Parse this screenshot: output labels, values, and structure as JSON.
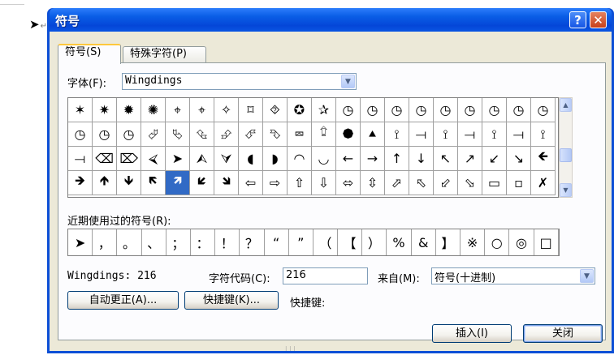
{
  "doc": {
    "mark_glyph": "➤",
    "return_glyph": "↵"
  },
  "window": {
    "title": "符号",
    "help_label": "?",
    "close_label": "✕"
  },
  "tabs": [
    {
      "label": "符号(S)",
      "active": true
    },
    {
      "label": "特殊字符(P)",
      "active": false
    }
  ],
  "font": {
    "label": "字体(F):",
    "value": "Wingdings"
  },
  "grid": {
    "selected_index": 64,
    "cells": [
      "✶",
      "✷",
      "✹",
      "✺",
      "⌖",
      "⌖",
      "✧",
      "⌑",
      "⯑",
      "✪",
      "✰",
      "◷",
      "◷",
      "◷",
      "◷",
      "◷",
      "◷",
      "◷",
      "◷",
      "◷",
      "◷",
      "◷",
      "◷",
      "⮰",
      "⮱",
      "⮴",
      "⮵",
      "⮶",
      "⮷",
      "⮹",
      "⮸",
      "⯄",
      "⯅",
      "⟟",
      "⟞",
      "⟟",
      "⟞",
      "⟟",
      "⟞",
      "⟟",
      "⟞",
      "⌫",
      "⌦",
      "⮘",
      "➤",
      "⮙",
      "⮛",
      "◖",
      "◗",
      "◠",
      "◡",
      "←",
      "→",
      "↑",
      "↓",
      "↖",
      "↗",
      "↙",
      "↘",
      "🡸",
      "🡺",
      "🡹",
      "🡻",
      "🡼",
      "🡽",
      "🡿",
      "🡾",
      "⇦",
      "⇨",
      "⇧",
      "⇩",
      "⬄",
      "⇳",
      "⬀",
      "⬁",
      "⬃",
      "⬂",
      "▭",
      "▫",
      "✗"
    ]
  },
  "recent": {
    "label": "近期使用过的符号(R):",
    "cells": [
      "➤",
      "，",
      "。",
      "、",
      "；",
      "：",
      "！",
      "？",
      "“",
      "”",
      "（",
      "【",
      "）",
      "%",
      "&",
      "】",
      "※",
      "○",
      "◎",
      "□"
    ]
  },
  "info": {
    "font_code": "Wingdings: 216"
  },
  "char_code": {
    "label": "字符代码(C):",
    "value": "216"
  },
  "from": {
    "label": "来自(M):",
    "value": "符号(十进制)"
  },
  "buttons": {
    "autocorrect": "自动更正(A)...",
    "shortcut_key": "快捷键(K)...",
    "shortcut_label": "快捷键:",
    "insert": "插入(I)",
    "close": "关闭"
  },
  "colors": {
    "title_bar": "#0a5ee6",
    "dialog_bg": "#ece9d8",
    "selection": "#316ac5"
  }
}
